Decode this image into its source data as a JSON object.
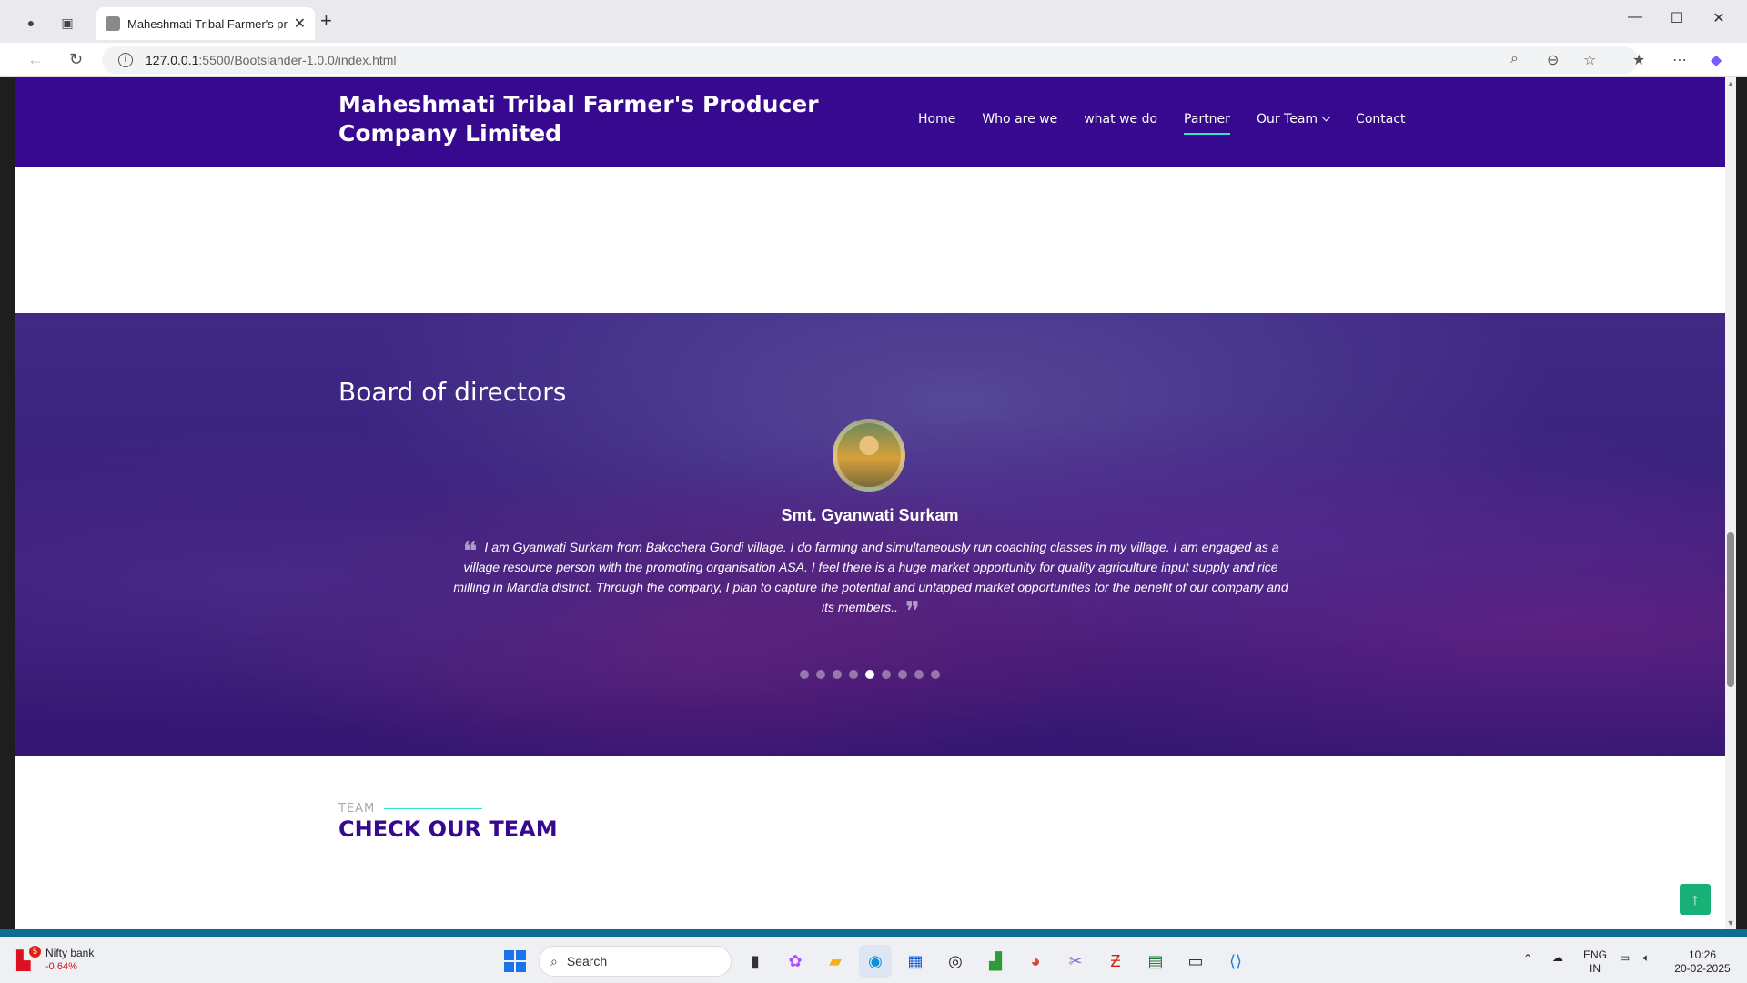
{
  "browser": {
    "tab_title": "Maheshmati Tribal Farmer's produ",
    "url_host": "127.0.0.1",
    "url_path": ":5500/Bootslander-1.0.0/index.html"
  },
  "site": {
    "logo": "Maheshmati Tribal Farmer's Producer Company Limited",
    "menu": [
      {
        "label": "Home"
      },
      {
        "label": "Who are we"
      },
      {
        "label": "what we do"
      },
      {
        "label": "Partner"
      },
      {
        "label": "Our Team"
      },
      {
        "label": "Contact"
      }
    ],
    "active_menu": "Partner",
    "accent_color": "#37098f",
    "underline_color": "#2ee6c8"
  },
  "testimonials": {
    "section_title": "Board of directors",
    "name": "Smt. Gyanwati Surkam",
    "quote": "I am Gyanwati Surkam from Bakcchera Gondi village. I do farming and simultaneously run coaching classes in my village. I am engaged as a village resource person with the promoting organisation ASA. I feel there is a huge market opportunity for quality agriculture input supply and rice milling in Mandla district. Through the company, I plan to capture the potential and untapped market opportunities for the benefit of our company and its members..",
    "slide_count": 9,
    "active_slide": 5
  },
  "team": {
    "label": "TEAM",
    "title": "CHECK OUR TEAM"
  },
  "taskbar": {
    "stock_name": "Nifty bank",
    "stock_change": "-0.64%",
    "stock_badge": "5",
    "search_placeholder": "Search",
    "lang_top": "ENG",
    "lang_bottom": "IN",
    "time": "10:26",
    "date": "20-02-2025"
  }
}
